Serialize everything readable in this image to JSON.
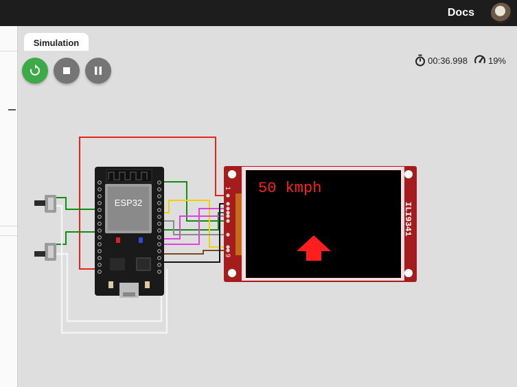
{
  "topbar": {
    "docs_label": "Docs"
  },
  "tabs": {
    "simulation_label": "Simulation"
  },
  "status": {
    "elapsed_time": "00:36.998",
    "speed": "19%"
  },
  "esp32": {
    "label": "ESP32"
  },
  "display": {
    "model_label": "ILI9341",
    "pin_first": "1",
    "pin_last": "9",
    "screen_text": "50 kmph",
    "text_color": "#ff1e1e",
    "arrow_color": "#ff1e1e",
    "arrow_icon": "up-arrow-icon",
    "board_color": "#a51c1c"
  },
  "wire_colors": {
    "red": "#e8231c",
    "green": "#0e8c14",
    "yellow": "#f2d100",
    "magenta": "#e040e0",
    "gray": "#8a8a8a",
    "brown": "#7a4a1a",
    "black": "#111111",
    "white": "#f4f4f4"
  },
  "buttons": {
    "restart_icon": "restart-icon",
    "stop_icon": "stop-icon",
    "pause_icon": "pause-icon"
  }
}
